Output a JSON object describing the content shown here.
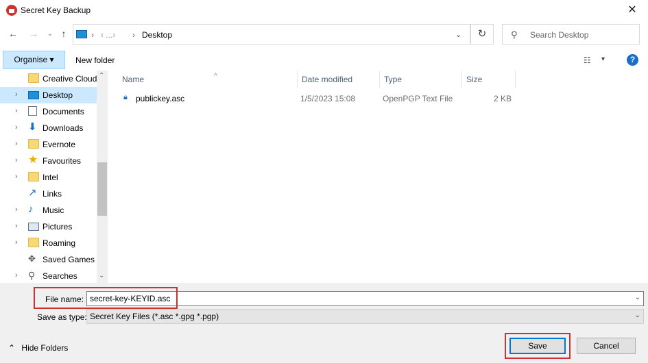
{
  "window": {
    "title": "Secret Key Backup",
    "close_glyph": "✕",
    "icon": "kleopatra-app-icon"
  },
  "nav": {
    "back_glyph": "←",
    "forward_glyph": "→",
    "recent_glyph": "⌄",
    "up_glyph": "↑",
    "breadcrumb_sep1": "›",
    "breadcrumb_hidden": "‹ ...›",
    "breadcrumb_sep2": "›",
    "current": "Desktop",
    "address_dropdown_glyph": "⌄",
    "refresh_glyph": "↻",
    "search_placeholder": "Search Desktop",
    "search_glyph": "⚲"
  },
  "toolbar": {
    "organise": "Organise ▾",
    "new_folder": "New folder",
    "view_glyph": "☷",
    "view_drop_glyph": "▾",
    "help_glyph": "?"
  },
  "sidebar": {
    "items": [
      {
        "label": "Creative Cloud",
        "chevron": "",
        "icon": "creative-cloud-icon"
      },
      {
        "label": "Desktop",
        "chevron": "›",
        "icon": "desktop-icon",
        "selected": true
      },
      {
        "label": "Documents",
        "chevron": "›",
        "icon": "documents-icon"
      },
      {
        "label": "Downloads",
        "chevron": "›",
        "icon": "downloads-icon"
      },
      {
        "label": "Evernote",
        "chevron": "›",
        "icon": "folder-icon"
      },
      {
        "label": "Favourites",
        "chevron": "›",
        "icon": "favourites-icon"
      },
      {
        "label": "Intel",
        "chevron": "›",
        "icon": "folder-icon"
      },
      {
        "label": "Links",
        "chevron": "",
        "icon": "links-icon"
      },
      {
        "label": "Music",
        "chevron": "›",
        "icon": "music-icon"
      },
      {
        "label": "Pictures",
        "chevron": "›",
        "icon": "pictures-icon"
      },
      {
        "label": "Roaming",
        "chevron": "›",
        "icon": "folder-icon"
      },
      {
        "label": "Saved Games",
        "chevron": "",
        "icon": "saved-games-icon"
      },
      {
        "label": "Searches",
        "chevron": "›",
        "icon": "searches-icon"
      }
    ],
    "scroll_up_glyph": "⌃",
    "scroll_down_glyph": "⌄"
  },
  "filelist": {
    "columns": [
      "Name",
      "Date modified",
      "Type",
      "Size"
    ],
    "sort_glyph": "^",
    "rows": [
      {
        "name": "publickey.asc",
        "date": "1/5/2023 15:08",
        "type": "OpenPGP Text File",
        "size": "2 KB"
      }
    ]
  },
  "form": {
    "file_name_label": "File name:",
    "file_name_value": "secret-key-KEYID.asc",
    "save_type_label": "Save as type:",
    "save_type_value": "Secret Key Files (*.asc *.gpg *.pgp)",
    "dropdown_glyph": "⌄",
    "hide_folders": "Hide Folders",
    "hide_folders_glyph": "⌃",
    "save": "Save",
    "cancel": "Cancel"
  },
  "colors": {
    "highlight": "#d0312d",
    "selection": "#cce8ff"
  }
}
